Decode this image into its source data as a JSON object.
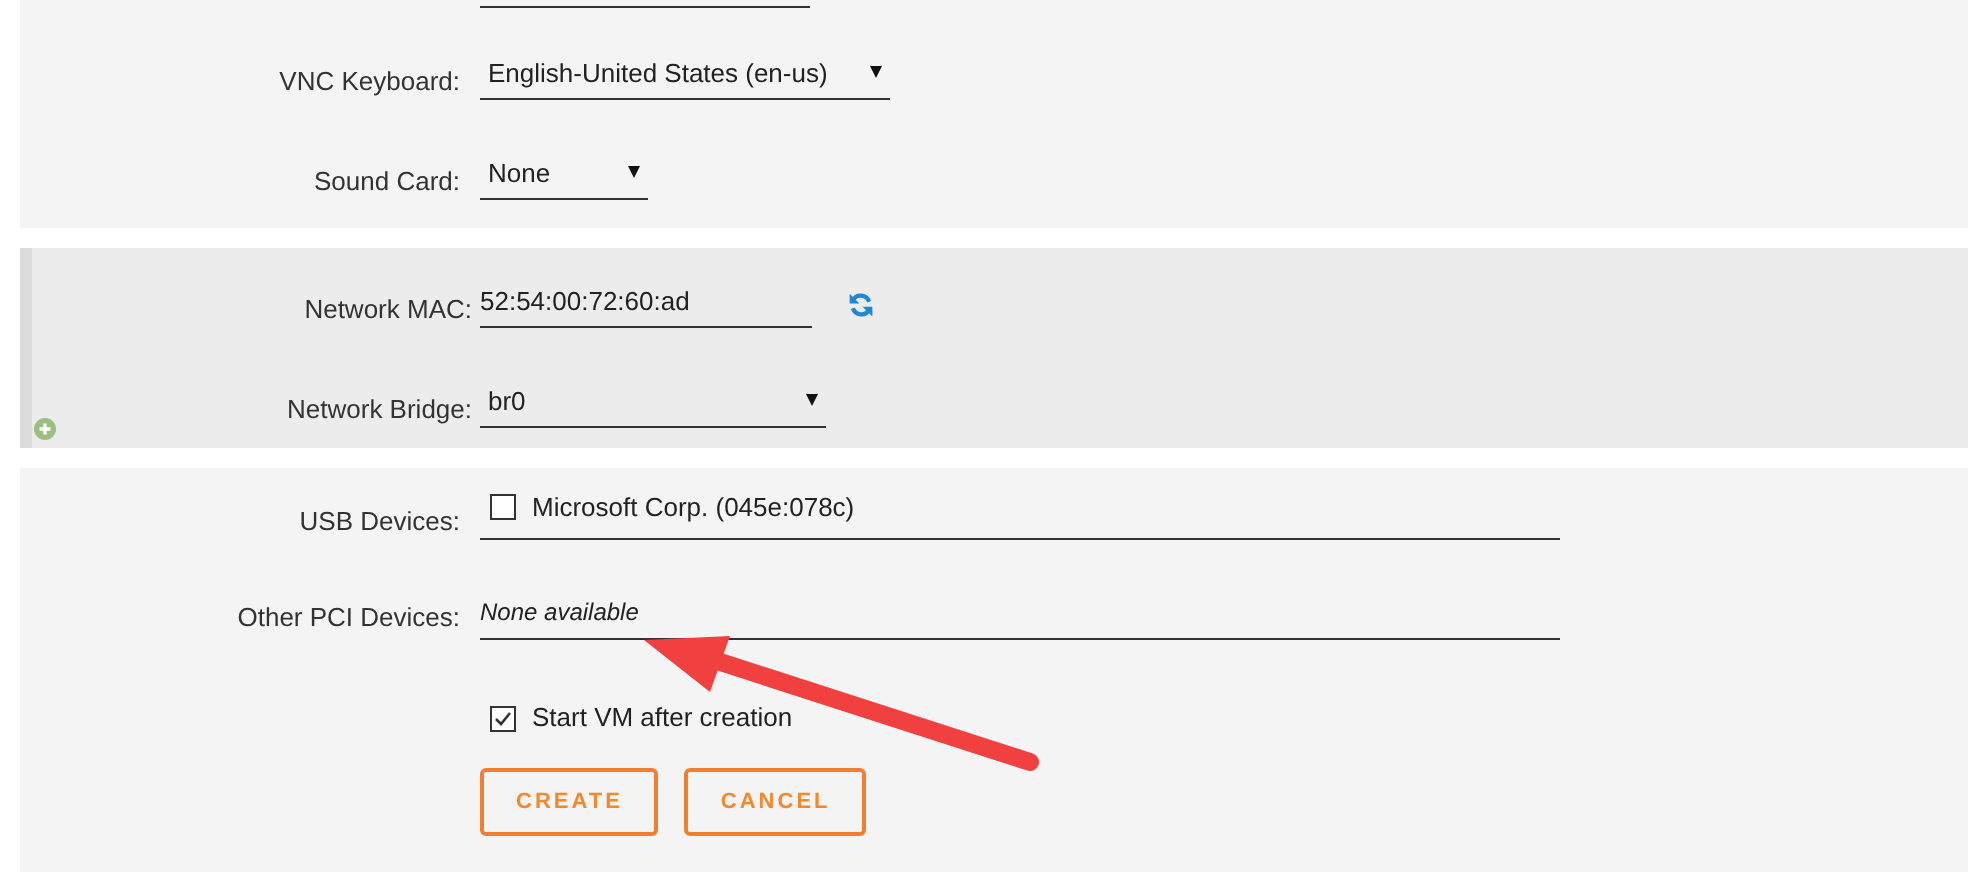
{
  "general": [
    {
      "label": "VNC Keyboard:",
      "value": "English-United States (en-us)"
    },
    {
      "label": "Sound Card:",
      "value": "None"
    }
  ],
  "network": {
    "mac": {
      "label": "Network MAC:",
      "value": "52:54:00:72:60:ad"
    },
    "bridge": {
      "label": "Network Bridge:",
      "value": "br0"
    }
  },
  "usb": {
    "label": "USB Devices:",
    "devices": [
      {
        "label": "Microsoft Corp. (045e:078c)",
        "checked": false
      }
    ]
  },
  "pci": {
    "label": "Other PCI Devices:",
    "value": "None available"
  },
  "start_vm": {
    "label": "Start VM after creation",
    "checked": true
  },
  "buttons": [
    "CREATE",
    "CANCEL"
  ]
}
